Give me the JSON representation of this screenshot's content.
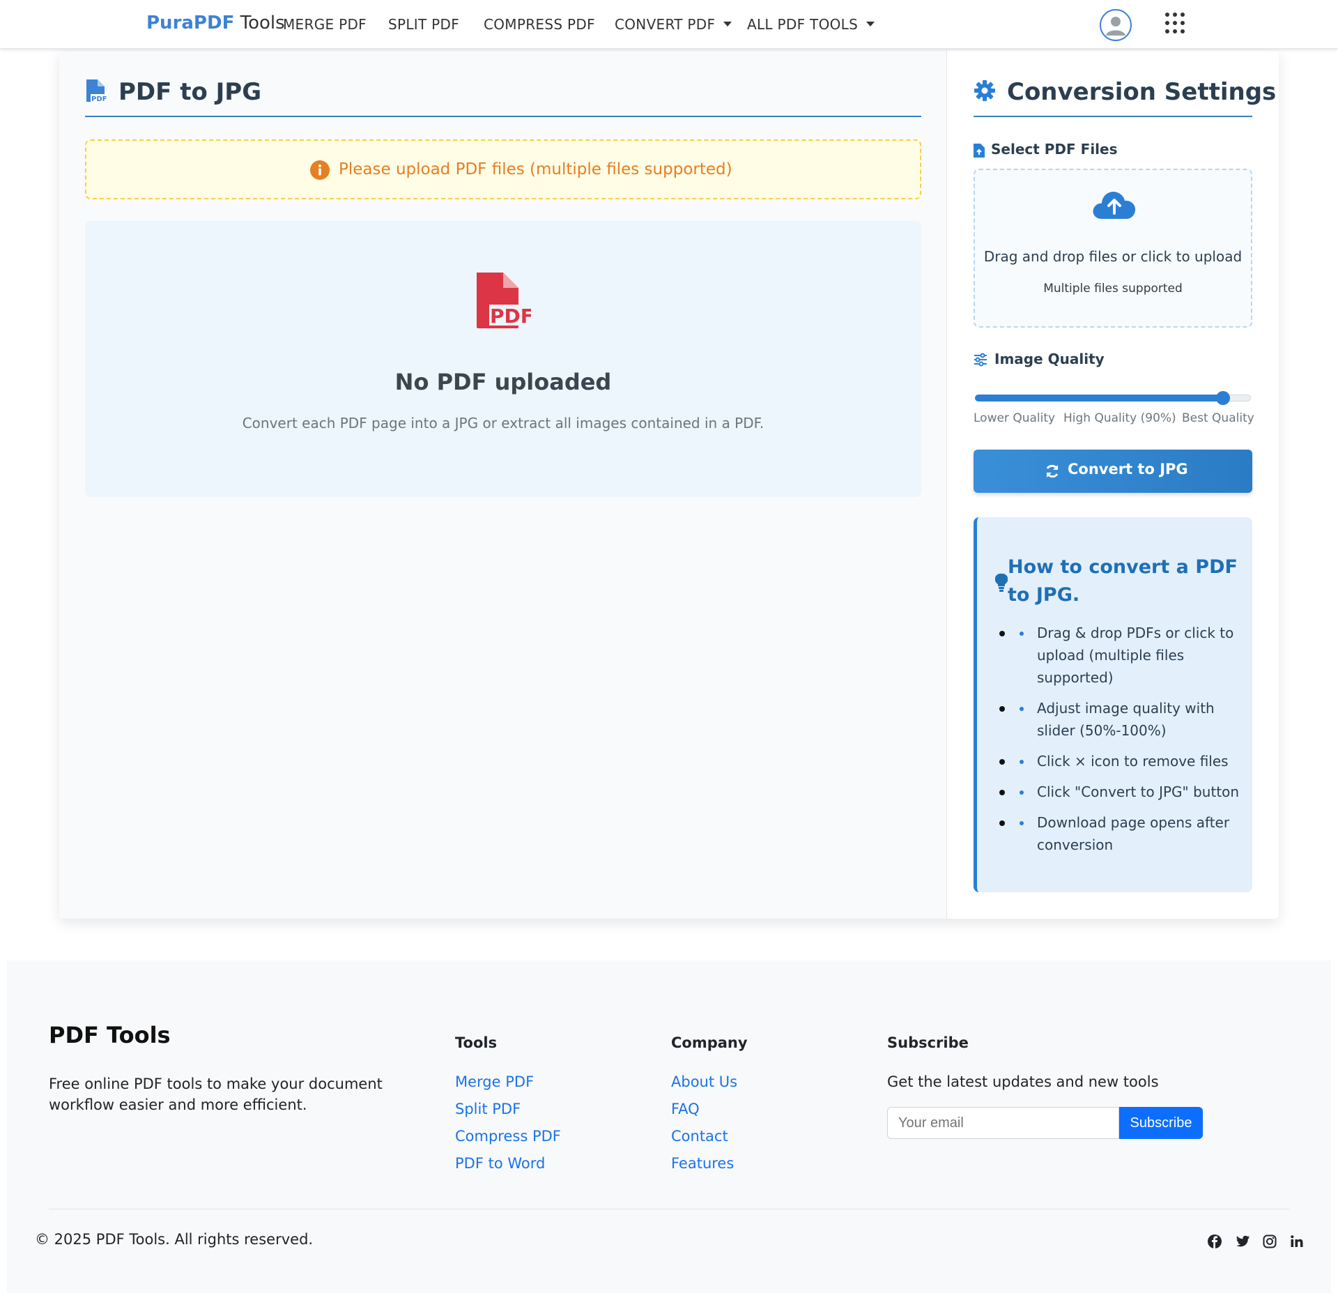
{
  "navbar": {
    "brand_primary": "PuraPDF",
    "brand_secondary": "Tools",
    "items": [
      {
        "label": "MERGE PDF"
      },
      {
        "label": "SPLIT PDF"
      },
      {
        "label": "COMPRESS PDF"
      },
      {
        "label": "CONVERT PDF"
      },
      {
        "label": "ALL PDF TOOLS"
      }
    ]
  },
  "main": {
    "title": "PDF to JPG",
    "alert": "Please upload PDF files (multiple files supported)",
    "empty_title": "No PDF uploaded",
    "empty_desc": "Convert each PDF page into a JPG or extract all images contained in a PDF.",
    "pdf_badge": "PDF"
  },
  "settings": {
    "title": "Conversion Settings",
    "select_label": "Select PDF Files",
    "upload_text": "Drag and drop files or click to upload",
    "upload_sub": "Multiple files supported",
    "quality_label": "Image Quality",
    "quality_value": 0.9,
    "quality_low": "Lower Quality",
    "quality_mid": "High Quality (90%)",
    "quality_high": "Best Quality",
    "convert_label": "Convert to JPG"
  },
  "howto": {
    "title": "How to convert a PDF to JPG.",
    "steps": [
      "Drag & drop PDFs or click to upload (multiple files supported)",
      "Adjust image quality with slider (50%-100%)",
      "Click × icon to remove files",
      "Click \"Convert to JPG\" button",
      "Download page opens after conversion"
    ]
  },
  "footer": {
    "brand": "PDF Tools",
    "description": "Free online PDF tools to make your document workflow easier and more efficient.",
    "tools_heading": "Tools",
    "tools": [
      "Merge PDF",
      "Split PDF",
      "Compress PDF",
      "PDF to Word"
    ],
    "company_heading": "Company",
    "company": [
      "About Us",
      "FAQ",
      "Contact",
      "Features"
    ],
    "subscribe_heading": "Subscribe",
    "subscribe_text": "Get the latest updates and new tools",
    "email_placeholder": "Your email",
    "subscribe_button": "Subscribe",
    "copyright": "© 2025 PDF Tools. All rights reserved.",
    "social": [
      "facebook-icon",
      "twitter-icon",
      "instagram-icon",
      "linkedin-icon"
    ]
  },
  "colors": {
    "accent": "#3d82d4",
    "primary_button": "#2a7fd4",
    "alert_text": "#e67e22",
    "pdf_red": "#dc3545",
    "link": "#1a73e8"
  }
}
